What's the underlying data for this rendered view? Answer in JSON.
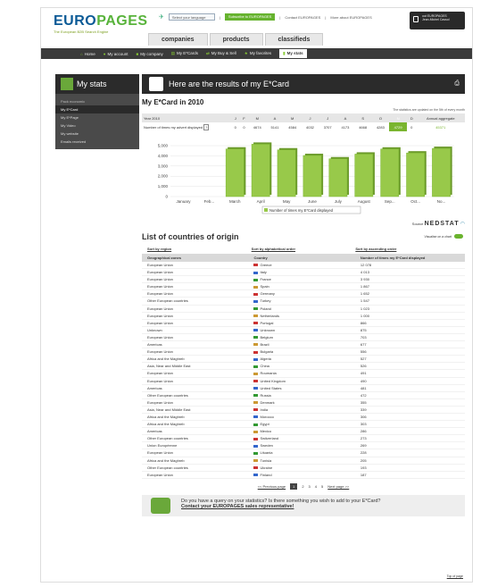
{
  "brand": {
    "logo_a": "EURO",
    "logo_b": "PAGES",
    "tagline": "The European B2B Search Engine"
  },
  "topbar": {
    "language": "Select your language",
    "subscribe": "Subscribe to EUROPAGES",
    "contact": "Contact EUROPAGES",
    "more": "More about EUROPAGES"
  },
  "login": {
    "line1": "out EUROPAGES",
    "line2": "Jean-Michel Cassol"
  },
  "category_tabs": [
    "companies",
    "products",
    "classifieds"
  ],
  "nav": [
    "Home",
    "My account",
    "My company",
    "My E*Cards",
    "My Buy & Sell",
    "My favorites",
    "My stats"
  ],
  "side": {
    "title": "My stats",
    "group": "Pack economic",
    "items": [
      "My E*Card",
      "My E*Page",
      "My Video",
      "My website",
      "Emails received"
    ]
  },
  "banner": {
    "title": "Here are the results of my E*Card",
    "print_icon": "printer-icon"
  },
  "ecard": {
    "title": "My E*Card in 2010",
    "note": "The statistics are updated on the 5th of every month",
    "year_label": "Year 2010",
    "months": [
      "J",
      "F",
      "M",
      "A",
      "M",
      "J",
      "J",
      "A",
      "S",
      "O",
      "N",
      "D"
    ],
    "agg_label": "Annual aggregate",
    "row_label": "Number of times my advert displayed",
    "help": "?",
    "values": [
      "0",
      "0",
      "4674",
      "5141",
      "4584",
      "4032",
      "3707",
      "4173",
      "4668",
      "4283",
      "4729",
      "0"
    ],
    "aggregate": "45371"
  },
  "chart_data": {
    "type": "bar",
    "categories": [
      "January",
      "Feb...",
      "March",
      "April",
      "May",
      "June",
      "July",
      "August",
      "Sep...",
      "Oct...",
      "No..."
    ],
    "values": [
      0,
      0,
      4674,
      5141,
      4584,
      4032,
      3707,
      4173,
      4668,
      4283,
      4729
    ],
    "ylim": [
      0,
      5000
    ],
    "yticks": [
      "0",
      "1,000",
      "2,000",
      "3,000",
      "4,000",
      "5,000"
    ],
    "legend": "Number of times my E*Card displayed",
    "accent": "#98c94a"
  },
  "source": {
    "label": "Source",
    "brand": "NEDSTAT"
  },
  "countries": {
    "title": "List of countries of origin",
    "visual": "Visualise on a chart",
    "sorts": [
      "Sort by region",
      "Sort by alphabetical order",
      "Sort by ascending order"
    ],
    "headers": [
      "Geographical zones",
      "Country",
      "Number of times my E*Card displayed"
    ],
    "rows": [
      [
        "European Union",
        "Greece",
        "12 078"
      ],
      [
        "European Union",
        "Italy",
        "4 013"
      ],
      [
        "European Union",
        "France",
        "3 930"
      ],
      [
        "European Union",
        "Spain",
        "1 867"
      ],
      [
        "European Union",
        "Germany",
        "1 652"
      ],
      [
        "Other European countries",
        "Turkey",
        "1 547"
      ],
      [
        "European Union",
        "Poland",
        "1 023"
      ],
      [
        "European Union",
        "Netherlands",
        "1 000"
      ],
      [
        "European Union",
        "Portugal",
        "866"
      ],
      [
        "Unknown",
        "Unknown",
        "875"
      ],
      [
        "European Union",
        "Belgium",
        "703"
      ],
      [
        "Americas",
        "Brazil",
        "677"
      ],
      [
        "European Union",
        "Bulgaria",
        "556"
      ],
      [
        "Africa and the Maghreb",
        "Algeria",
        "527"
      ],
      [
        "Asia, Near and Middle East",
        "China",
        "526"
      ],
      [
        "European Union",
        "Roumania",
        "491"
      ],
      [
        "European Union",
        "United Kingdom",
        "490"
      ],
      [
        "Americas",
        "United States",
        "481"
      ],
      [
        "Other European countries",
        "Russia",
        "472"
      ],
      [
        "European Union",
        "Denmark",
        "355"
      ],
      [
        "Asia, Near and Middle East",
        "India",
        "339"
      ],
      [
        "Africa and the Maghreb",
        "Morocco",
        "306"
      ],
      [
        "Africa and the Maghreb",
        "Egypt",
        "303"
      ],
      [
        "Americas",
        "Mexico",
        "286"
      ],
      [
        "Other European countries",
        "Switzerland",
        "273"
      ],
      [
        "Union Européenne",
        "Sweden",
        "269"
      ],
      [
        "European Union",
        "Lituania",
        "228"
      ],
      [
        "Africa and the Maghreb",
        "Tunisia",
        "205"
      ],
      [
        "Other European countries",
        "Ukraine",
        "193"
      ],
      [
        "European Union",
        "Finland",
        "187"
      ]
    ]
  },
  "pager": {
    "prev": "<< Previous page",
    "pages": [
      "1",
      "2",
      "3",
      "4",
      "5"
    ],
    "next": "Next page >>"
  },
  "query": {
    "line1": "Do you have a query on your statistics? Is there something you wish to add to your E*Card?",
    "line2": "Contact your EUROPAGES sales representative!"
  },
  "top": "Top of page"
}
